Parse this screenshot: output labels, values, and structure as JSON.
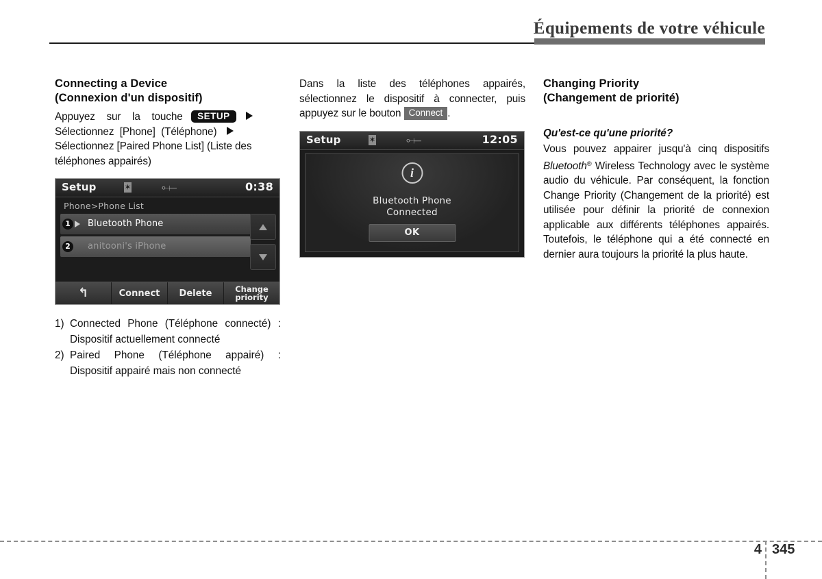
{
  "header": {
    "title": "Équipements de votre véhicule"
  },
  "footer": {
    "chapter": "4",
    "page": "345"
  },
  "col1": {
    "section_title_line1": "Connecting a Device",
    "section_title_line2": "(Connexion d'un dispositif)",
    "steps": {
      "l1_a": "Appuyez",
      "l1_b": "sur",
      "l1_c": "la",
      "l1_d": "touche",
      "setup_button": "SETUP",
      "l2_a": "Sélectionnez",
      "l2_b": "[Phone]",
      "l2_c": "(Téléphone)",
      "l3": "Sélectionnez [Paired Phone List] (Liste des téléphones appairés)"
    },
    "screenshot": {
      "status_title": "Setup",
      "status_clock": "0:38",
      "bt_icon": "bluetooth-icon",
      "usb_icon": "usb-icon",
      "breadcrumb": "Phone>Phone List",
      "rows": [
        {
          "num": "1",
          "label": "Bluetooth Phone",
          "state": "selected"
        },
        {
          "num": "2",
          "label": "anitooni's iPhone",
          "state": "paired"
        }
      ],
      "scroll_up": "scroll-up-icon",
      "scroll_down": "scroll-down-icon",
      "buttons": {
        "back": "↰",
        "connect": "Connect",
        "delete": "Delete",
        "change_priority_l1": "Change",
        "change_priority_l2": "priority"
      }
    },
    "notes": [
      {
        "marker": "1)",
        "text": "Connected Phone (Téléphone connecté) : Dispositif actuellement connecté"
      },
      {
        "marker": "2)",
        "text": "Paired Phone (Téléphone appairé) : Dispositif appairé mais non connecté"
      }
    ]
  },
  "col2": {
    "intro_a": "Dans la liste des téléphones appairés, sélectionnez le dispositif à connecter, puis appuyez sur le bouton",
    "connect_button": "Connect",
    "intro_b": ".",
    "screenshot": {
      "status_title": "Setup",
      "status_clock": "12:05",
      "bt_icon": "bluetooth-icon",
      "usb_icon": "usb-icon",
      "info_icon": "info-icon",
      "message_line1": "Bluetooth Phone",
      "message_line2": "Connected",
      "ok_button": "OK"
    }
  },
  "col3": {
    "section_title_line1": "Changing Priority",
    "section_title_line2": "(Changement de priorité)",
    "subhead": "Qu'est-ce qu'une priorité?",
    "body_a": "Vous pouvez appairer jusqu'à cinq dispositifs",
    "brand": "Bluetooth",
    "brand_reg": "®",
    "body_b": "Wireless Technology avec le système audio du véhicule. Par conséquent, la fonction Change Priority (Changement de la priorité) est utilisée pour définir la priorité de connexion applicable aux différents téléphones appairés. Toutefois, le téléphone qui a été connecté en dernier aura toujours la priorité la plus haute."
  }
}
